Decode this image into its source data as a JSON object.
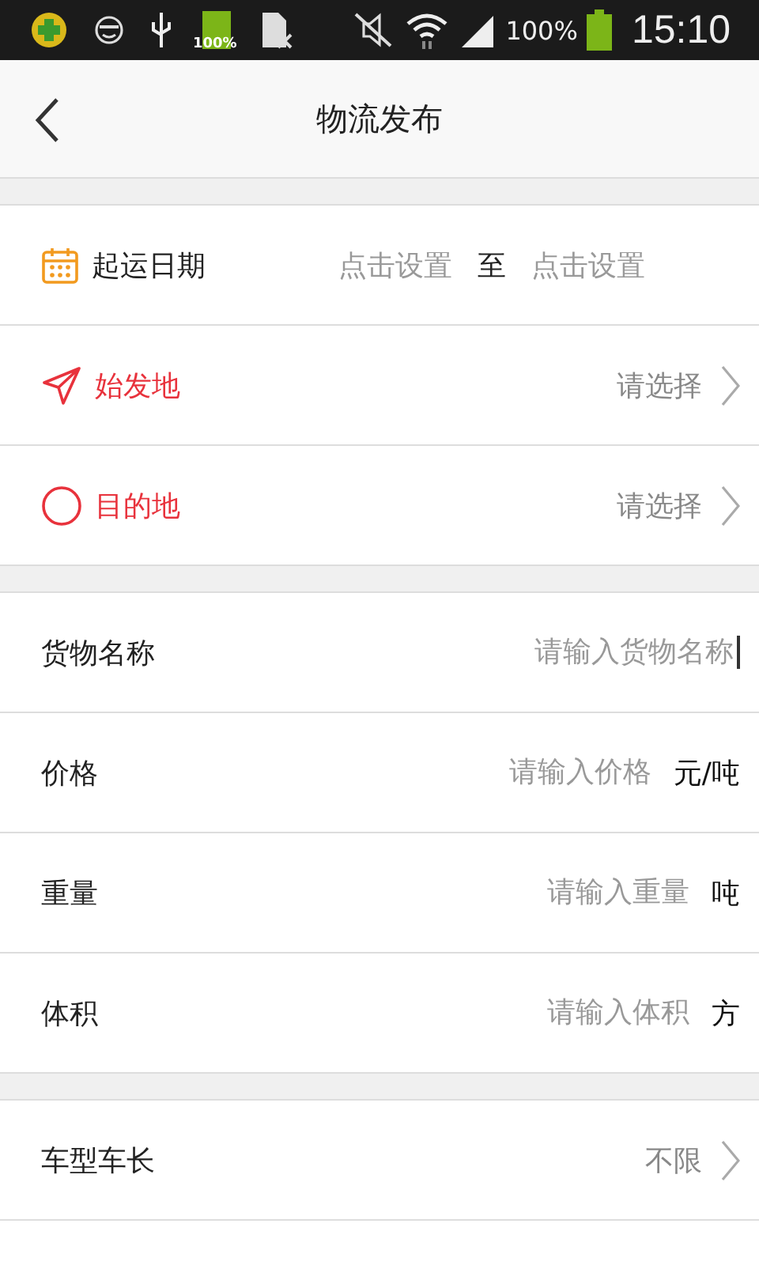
{
  "status_bar": {
    "battery_badge": "100%",
    "battery": "100%",
    "time": "15:10"
  },
  "header": {
    "title": "物流发布"
  },
  "sections": [
    [
      {
        "kind": "date",
        "label": "起运日期",
        "start": "点击设置",
        "separator": "至",
        "end": "点击设置"
      },
      {
        "kind": "origin",
        "label": "始发地",
        "value": "请选择"
      },
      {
        "kind": "destination",
        "label": "目的地",
        "value": "请选择"
      }
    ],
    [
      {
        "kind": "input",
        "label": "货物名称",
        "placeholder": "请输入货物名称",
        "focused": true
      },
      {
        "kind": "input",
        "label": "价格",
        "placeholder": "请输入价格",
        "unit": "元/吨",
        "focused": false
      },
      {
        "kind": "input",
        "label": "重量",
        "placeholder": "请输入重量",
        "unit": "吨",
        "focused": false
      },
      {
        "kind": "input",
        "label": "体积",
        "placeholder": "请输入体积",
        "unit": "方",
        "focused": false
      }
    ],
    [
      {
        "kind": "select",
        "label": "车型车长",
        "value": "不限"
      }
    ]
  ]
}
